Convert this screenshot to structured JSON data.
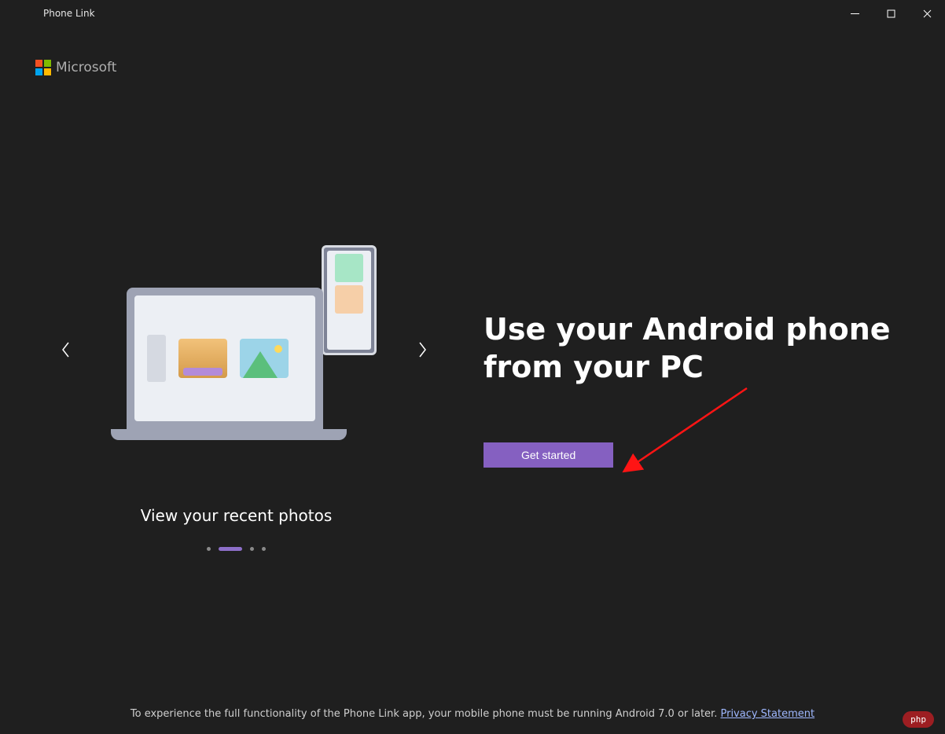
{
  "window": {
    "title": "Phone Link"
  },
  "brand": {
    "name": "Microsoft"
  },
  "carousel": {
    "caption": "View your recent photos",
    "active_index": 1,
    "count": 4
  },
  "main": {
    "headline": "Use your Android phone from your PC",
    "cta_label": "Get started"
  },
  "footer": {
    "text": "To experience the full functionality of the Phone Link app, your mobile phone must be running Android 7.0 or later. ",
    "link_label": "Privacy Statement"
  },
  "watermark": "php"
}
